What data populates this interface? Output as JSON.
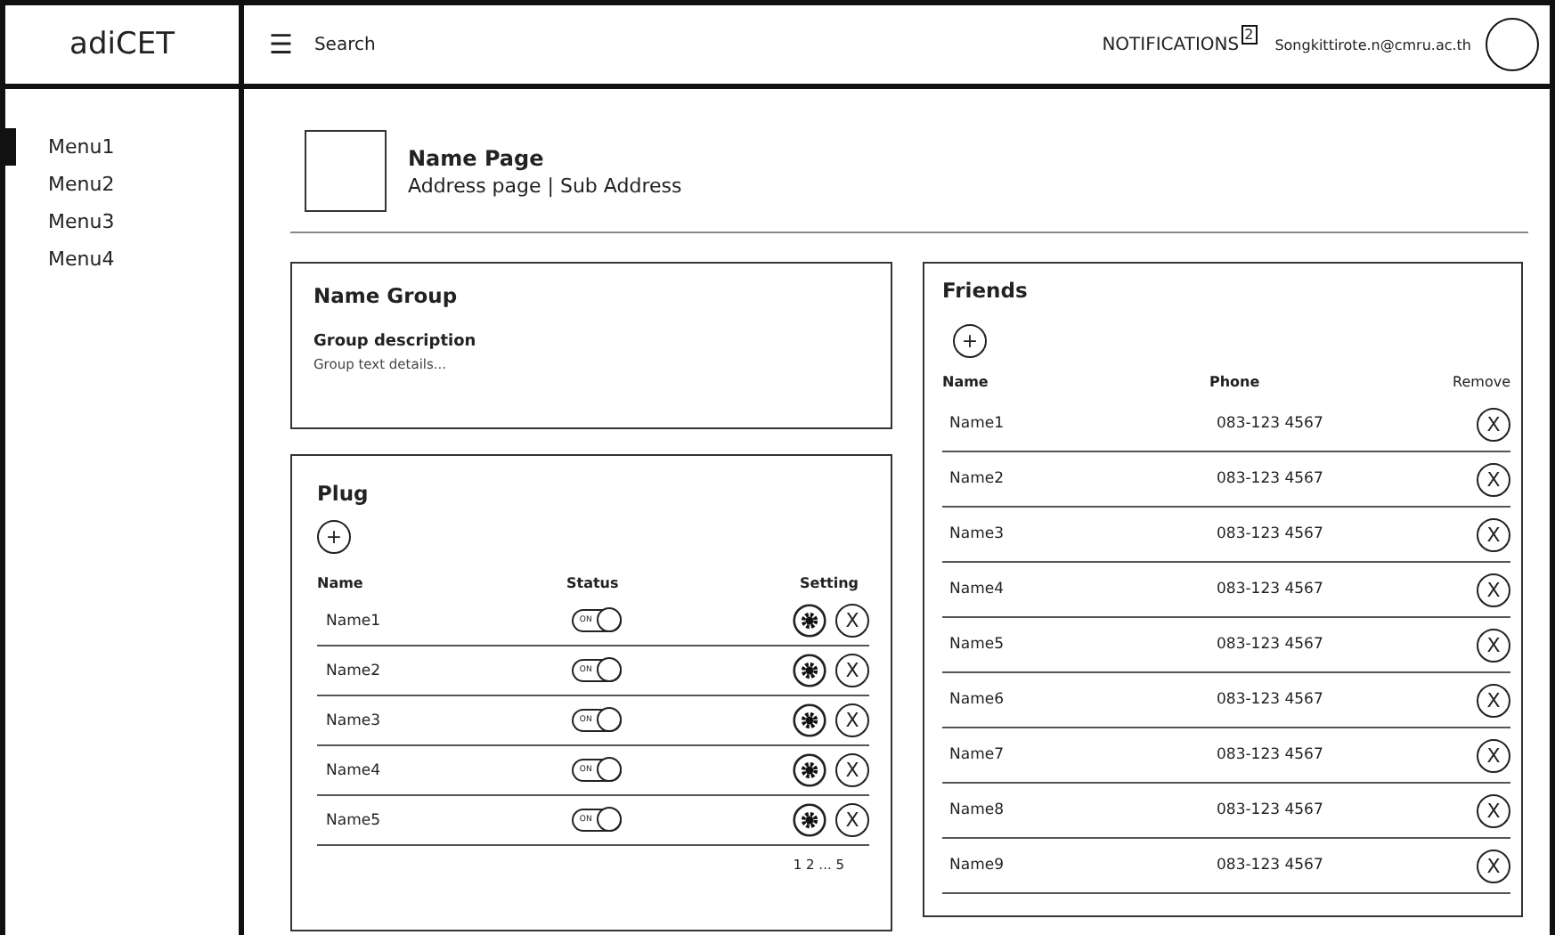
{
  "logo": "adiCET",
  "header": {
    "menu_glyph": "☰",
    "search": "Search",
    "notifications": "NOTIFICATIONS",
    "notification_count": "2",
    "email": "Songkittirote.n@cmru.ac.th"
  },
  "sidebar": {
    "items": [
      {
        "label": "Menu1",
        "selected": true
      },
      {
        "label": "Menu2",
        "selected": false
      },
      {
        "label": "Menu3",
        "selected": false
      },
      {
        "label": "Menu4",
        "selected": false
      }
    ]
  },
  "page": {
    "title": "Name Page",
    "breadcrumb": "Address page | Sub Address"
  },
  "group": {
    "title": "Name Group",
    "description_title": "Group description",
    "description": "Group text details..."
  },
  "plug": {
    "title": "Plug",
    "add": "+",
    "columns": [
      "Name",
      "Status",
      "Setting"
    ],
    "rows": [
      {
        "name": "Name1",
        "on": true,
        "toggle_label": "ON",
        "delete": "X"
      },
      {
        "name": "Name2",
        "on": true,
        "toggle_label": "ON",
        "delete": "X"
      },
      {
        "name": "Name3",
        "on": true,
        "toggle_label": "ON",
        "delete": "X"
      },
      {
        "name": "Name4",
        "on": true,
        "toggle_label": "ON",
        "delete": "X"
      },
      {
        "name": "Name5",
        "on": true,
        "toggle_label": "ON",
        "delete": "X"
      }
    ],
    "pagination": "1 2 ... 5"
  },
  "friends": {
    "title": "Friends",
    "add": "+",
    "columns": [
      "Name",
      "Phone",
      "Remove"
    ],
    "rows": [
      {
        "name": "Name1",
        "phone": "083-123 4567",
        "remove": "X"
      },
      {
        "name": "Name2",
        "phone": "083-123 4567",
        "remove": "X"
      },
      {
        "name": "Name3",
        "phone": "083-123 4567",
        "remove": "X"
      },
      {
        "name": "Name4",
        "phone": "083-123 4567",
        "remove": "X"
      },
      {
        "name": "Name5",
        "phone": "083-123 4567",
        "remove": "X"
      },
      {
        "name": "Name6",
        "phone": "083-123 4567",
        "remove": "X"
      },
      {
        "name": "Name7",
        "phone": "083-123 4567",
        "remove": "X"
      },
      {
        "name": "Name8",
        "phone": "083-123 4567",
        "remove": "X"
      },
      {
        "name": "Name9",
        "phone": "083-123 4567",
        "remove": "X"
      }
    ]
  }
}
